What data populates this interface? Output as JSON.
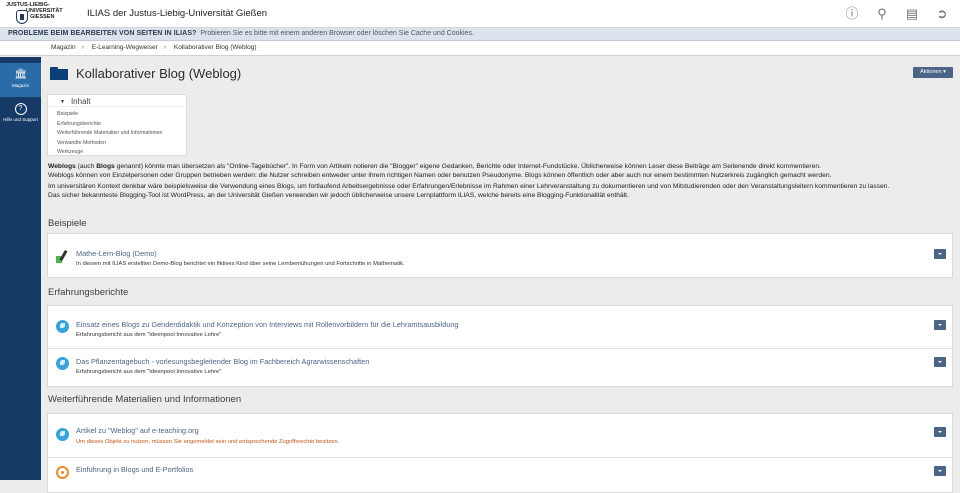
{
  "header": {
    "logo_lines": [
      "JUSTUS-LIEBIG-",
      "UNIVERSITÄT",
      "GIESSEN"
    ],
    "app_title": "ILIAS der Justus-Liebig-Universität Gießen",
    "icons": [
      "help-icon",
      "search-icon",
      "notifications-icon",
      "logout-icon"
    ]
  },
  "notice": {
    "bold": "PROBLEME BEIM BEARBEITEN VON SEITEN IN ILIAS?",
    "text": "Probieren Sie es bitte mit einem anderen Browser oder löschen Sie Cache und Cookies."
  },
  "breadcrumb": [
    "Magazin",
    "E-Learning-Wegweiser",
    "Kollaborativer Blog (Weblog)"
  ],
  "mainbar": {
    "items": [
      {
        "label": "Magazin",
        "icon": "repository-icon"
      },
      {
        "label": "Hilfe und Support",
        "icon": "help-icon"
      }
    ]
  },
  "page": {
    "title": "Kollaborativer Blog (Weblog)",
    "actions_label": "Aktionen ▾"
  },
  "toc": {
    "title": "Inhalt",
    "items": [
      "Beispiele",
      "Erfahrungsberichte",
      "Weiterführende Materialien und Informationen",
      "Verwandte Methoden",
      "Werkzeuge"
    ]
  },
  "intro": {
    "p1_a": "Weblogs",
    "p1_b": " (auch ",
    "p1_c": "Blogs",
    "p1_d": " genannt) könnte man übersetzen als \"Online-Tagebücher\". In Form von Artikeln notieren die \"Blogger\" eigene Gedanken, Berichte oder Internet-Fundstücke. Üblicherweise können Leser diese Beiträge am Seitenende direkt kommentieren.",
    "p1_e": "Weblogs können von Einzelpersonen oder Gruppen betrieben werden: die Nutzer schreiben entweder unter ihrem richtigen Namen oder benutzen Pseudonyme. Blogs können öffentlich oder aber auch nur einem bestimmten Nutzerkreis zugänglich gemacht werden.",
    "p2": "Im universitären Kontext denkbar wäre beispielsweise die Verwendung eines Blogs, um fortlaufend Arbeitsergebnisse oder Erfahrungen/Erlebnisse im Rahmen einer Lehrveranstaltung zu dokumentieren und von Mitstudierenden oder den Veranstaltungsleitern kommentieren zu lassen.",
    "p3": "Das sicher bekannteste Blogging-Tool ist WordPress, an der Universität Gießen verwenden wir jedoch üblicherweise unsere Lernplattform ILIAS, welche bereits eine Blogging-Funktionalität enthält."
  },
  "sections": {
    "beispiele": {
      "title": "Beispiele",
      "items": [
        {
          "title": "Mathe-Lern-Blog (Demo)",
          "desc": "In diesem mit ILIAS erstellten Demo-Blog berichtet ein fiktives Kind über seine Lernbemühungen und Fortschritte in Mathematik.",
          "icon": "blog-icon"
        }
      ]
    },
    "erfahrung": {
      "title": "Erfahrungsberichte",
      "items": [
        {
          "title": "Einsatz eines Blogs zu Genderdidaktik und Konzeption von Interviews mit Rollenvorbildern für die Lehramtsausbildung",
          "desc": "Erfahrungsbericht aus dem \"Ideenpool Innovative Lehre\"",
          "icon": "weblink-icon"
        },
        {
          "title": "Das Pflanzentagebuch - vorlesungsbegleitender Blog im Fachbereich Agrarwissenschaften",
          "desc": "Erfahrungsbericht aus dem \"Ideenpool Innovative Lehre\"",
          "icon": "weblink-icon"
        }
      ]
    },
    "weiter": {
      "title": "Weiterführende Materialien und Informationen",
      "items": [
        {
          "title": "Artikel zu \"Weblog\" auf e-teaching.org",
          "desc": "Um dieses Objekt zu nutzen, müssen Sie angemeldet sein und entsprechende Zugriffsrechte besitzen.",
          "icon": "weblink-icon"
        },
        {
          "title": "Einführung in Blogs und E-Portfolios",
          "desc": "",
          "icon": "webresource-icon"
        }
      ]
    }
  }
}
